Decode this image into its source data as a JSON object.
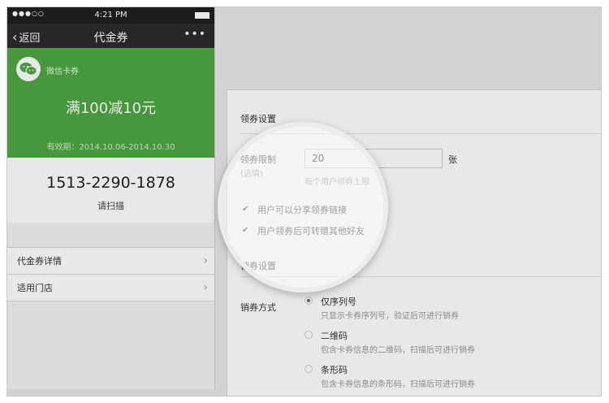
{
  "phone": {
    "status": {
      "signal": "●●●○○",
      "time": "4:21 PM"
    },
    "nav": {
      "back_label": "返回",
      "title": "代金券",
      "more": "•••"
    },
    "coupon": {
      "brand": "微信卡券",
      "amount": "满100减10元",
      "validity": "有效期：2014.10.06-2014.10.30",
      "color": "#4fa844"
    },
    "code": {
      "number": "1513-2290-1878",
      "hint": "请扫描"
    },
    "cells": [
      {
        "label": "代金券详情"
      },
      {
        "label": "适用门店"
      }
    ]
  },
  "settings": {
    "claim_section": {
      "title": "领券设置",
      "limit_label": "领券限制",
      "limit_optional": "(选填)",
      "limit_value": "20",
      "limit_unit": "张",
      "limit_help": "每个用户领券上限",
      "options": [
        {
          "label": "用户可以分享领券链接",
          "checked": true
        },
        {
          "label": "用户领券后可转赠其他好友",
          "checked": true
        }
      ]
    },
    "redeem_section": {
      "title": "销券设置",
      "method_label": "销券方式",
      "methods": [
        {
          "title": "仅序列号",
          "desc": "只显示卡券序列号，验证后可进行销券",
          "selected": true
        },
        {
          "title": "二维码",
          "desc": "包含卡券信息的二维码，扫描后可进行销券",
          "selected": false
        },
        {
          "title": "条形码",
          "desc": "包含卡券信息的条形码，扫描后可进行销券",
          "selected": false
        }
      ]
    }
  }
}
